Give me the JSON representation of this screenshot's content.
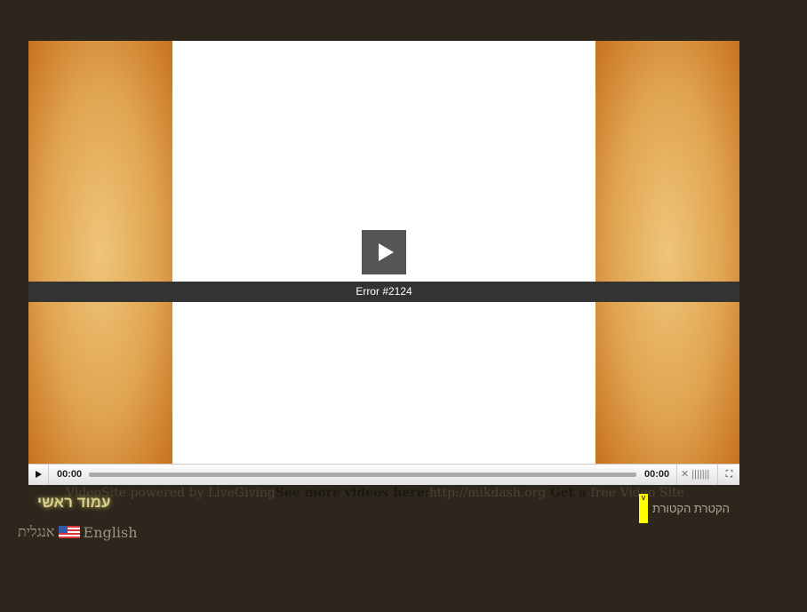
{
  "player": {
    "error": "Error #2124",
    "time_current": "00:00",
    "time_total": "00:00"
  },
  "credits": {
    "powered": "VideoSite powered by LiveGiving",
    "more": "See more videos here:",
    "url": "http://mikdash.org",
    "get": "Get a",
    "free": "free Video Site"
  },
  "nav": {
    "home": "עמוד ראשי",
    "lang_he": "אנגלית",
    "lang_en": "English",
    "ketoret": "הקטרת הקטורת",
    "marker": "v"
  }
}
